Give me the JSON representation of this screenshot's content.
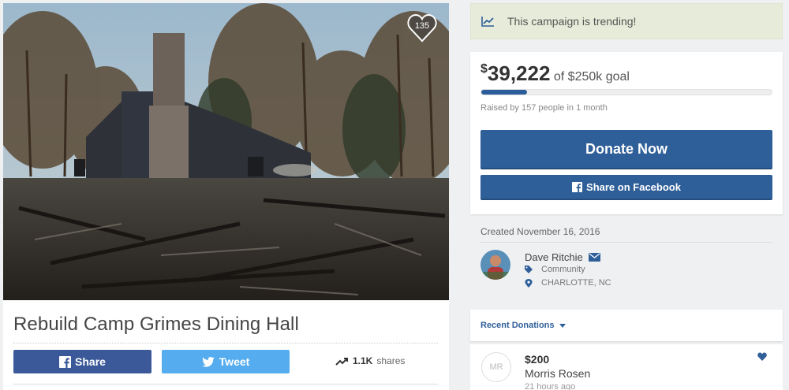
{
  "campaign": {
    "title": "Rebuild Camp Grimes Dining Hall",
    "hearts": "135",
    "share_label": "Share",
    "tweet_label": "Tweet",
    "shares_count": "1.1K",
    "shares_label": "shares"
  },
  "trending": {
    "text": "This campaign is trending!"
  },
  "funding": {
    "currency": "$",
    "raised": "39,222",
    "goal_text": "of $250k goal",
    "progress_fraction": 0.157,
    "raised_by": "Raised by 157 people in 1 month",
    "donate_label": "Donate Now",
    "facebook_label": "Share on Facebook"
  },
  "organizer": {
    "created": "Created November 16, 2016",
    "name": "Dave Ritchie",
    "category": "Community",
    "location": "CHARLOTTE, NC"
  },
  "recent": {
    "header": "Recent Donations",
    "items": [
      {
        "initials": "MR",
        "amount": "$200",
        "name": "Morris Rosen",
        "time": "21 hours ago"
      }
    ]
  },
  "colors": {
    "facebook": "#3b5998",
    "twitter": "#55acee",
    "primary": "#2f5f99",
    "trend_bg": "#e6ecd9"
  }
}
